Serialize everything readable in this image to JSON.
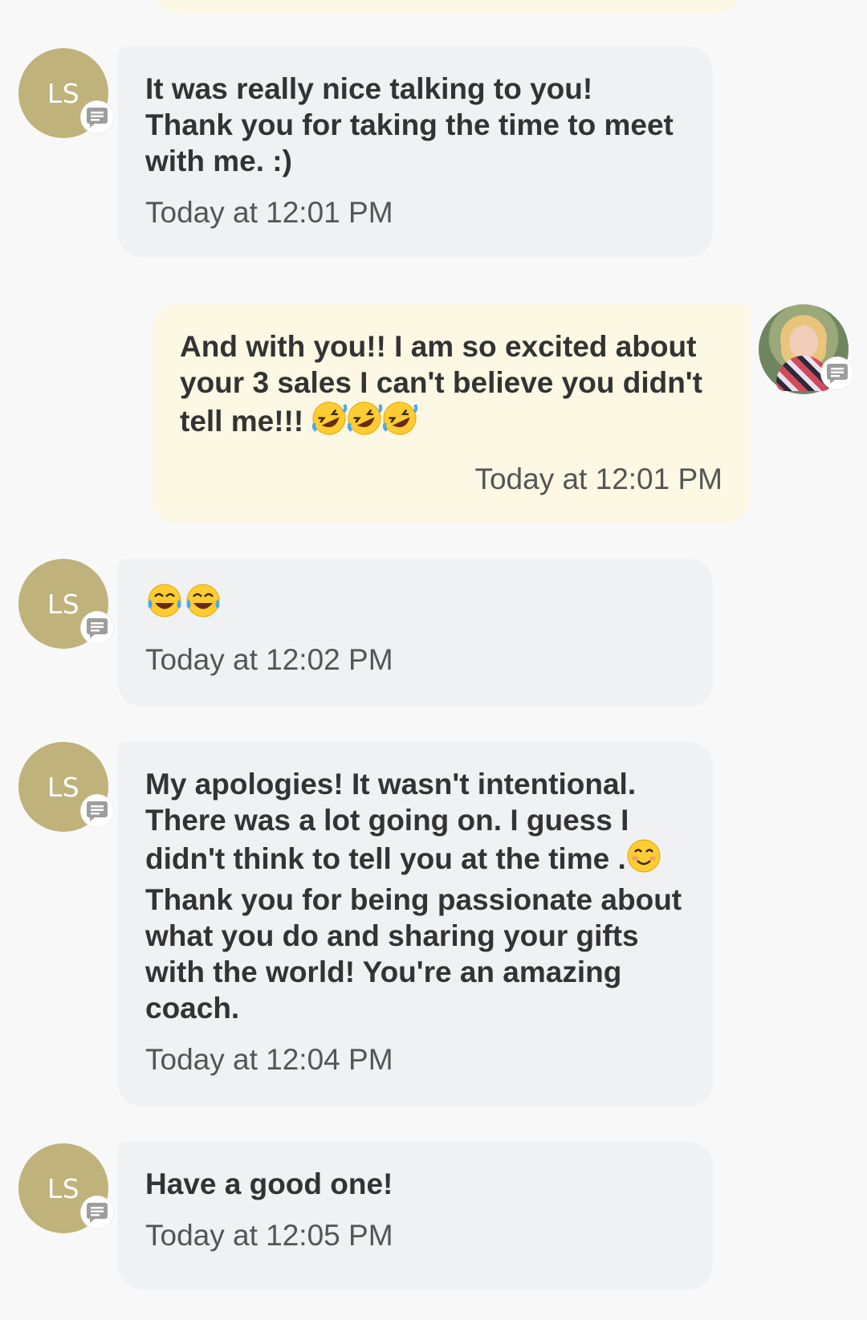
{
  "messages": [
    {
      "sender_initials": "LS",
      "direction": "incoming",
      "text": "It was really nice talking to you! Thank you for taking the time to meet with me. :)",
      "time": "Today at 12:01 PM"
    },
    {
      "direction": "outgoing",
      "text": "And with you!! I am so excited about your 3 sales I can't believe you didn't tell me!!!",
      "emoji": [
        "rolling-on-floor-laughing",
        "rolling-on-floor-laughing",
        "rolling-on-floor-laughing"
      ],
      "time": "Today at 12:01 PM"
    },
    {
      "sender_initials": "LS",
      "direction": "incoming",
      "text": "",
      "emoji": [
        "tears-of-joy",
        "tears-of-joy"
      ],
      "time": "Today at 12:02 PM"
    },
    {
      "sender_initials": "LS",
      "direction": "incoming",
      "text_before_emoji": "My apologies! It wasn't intentional. There was a lot going on. I guess I didn't think to tell you at the time .",
      "emoji": [
        "smiling-face"
      ],
      "text_after_emoji": "Thank you for being passionate about what you do and sharing your gifts with the world! You're an amazing coach.",
      "time": "Today at 12:04 PM"
    },
    {
      "sender_initials": "LS",
      "direction": "incoming",
      "text": "Have a good one!",
      "time": "Today at 12:05 PM"
    }
  ],
  "colors": {
    "background": "#f8f8f8",
    "incoming_bubble": "#f0f1f3",
    "outgoing_bubble": "#fdf8e4",
    "avatar_gold": "#bfb27a",
    "text": "#333333",
    "timestamp": "#555555"
  }
}
